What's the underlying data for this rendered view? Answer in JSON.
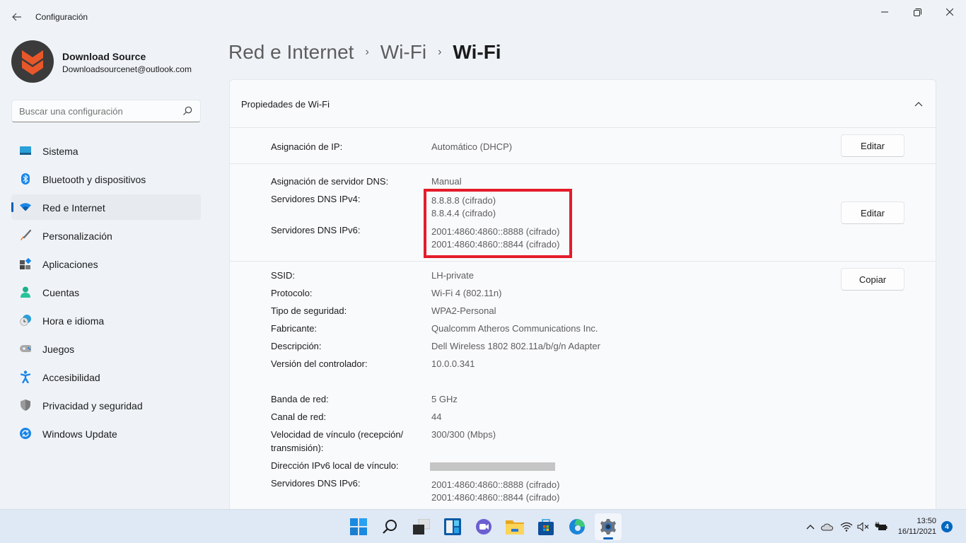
{
  "window": {
    "title": "Configuración",
    "back_icon": "arrow-left-icon",
    "controls": [
      "minimize-icon",
      "maximize-icon",
      "close-icon"
    ]
  },
  "profile": {
    "name": "Download Source",
    "email": "Downloadsourcenet@outlook.com",
    "avatar_icon": "download-source-logo-icon"
  },
  "search": {
    "placeholder": "Buscar una configuración",
    "value": "",
    "icon": "search-icon"
  },
  "sidebar": {
    "items": [
      {
        "label": "Sistema",
        "icon": "system-display-icon",
        "active": false
      },
      {
        "label": "Bluetooth y dispositivos",
        "icon": "bluetooth-icon",
        "active": false
      },
      {
        "label": "Red e Internet",
        "icon": "wifi-icon",
        "active": true
      },
      {
        "label": "Personalización",
        "icon": "paintbrush-icon",
        "active": false
      },
      {
        "label": "Aplicaciones",
        "icon": "apps-icon",
        "active": false
      },
      {
        "label": "Cuentas",
        "icon": "account-icon",
        "active": false
      },
      {
        "label": "Hora e idioma",
        "icon": "clock-globe-icon",
        "active": false
      },
      {
        "label": "Juegos",
        "icon": "gamepad-icon",
        "active": false
      },
      {
        "label": "Accesibilidad",
        "icon": "accessibility-icon",
        "active": false
      },
      {
        "label": "Privacidad y seguridad",
        "icon": "shield-icon",
        "active": false
      },
      {
        "label": "Windows Update",
        "icon": "windows-update-icon",
        "active": false
      }
    ]
  },
  "breadcrumb": {
    "items": [
      "Red e Internet",
      "Wi-Fi",
      "Wi-Fi"
    ],
    "separator": "›"
  },
  "card": {
    "title": "Propiedades de Wi-Fi",
    "collapse_icon": "chevron-up-icon",
    "ip_section": {
      "label": "Asignación de IP:",
      "value": "Automático (DHCP)",
      "button": "Editar"
    },
    "dns_section": {
      "assignment_label": "Asignación de servidor DNS:",
      "assignment_value": "Manual",
      "ipv4_label": "Servidores DNS IPv4:",
      "ipv4_values": [
        "8.8.8.8 (cifrado)",
        "8.8.4.4 (cifrado)"
      ],
      "ipv6_label": "Servidores DNS IPv6:",
      "ipv6_values": [
        "2001:4860:4860::8888 (cifrado)",
        "2001:4860:4860::8844 (cifrado)"
      ],
      "button": "Editar",
      "highlight_color": "#e41c2a"
    },
    "details_section": {
      "button": "Copiar",
      "rows": [
        {
          "label": "SSID:",
          "value": "LH-private"
        },
        {
          "label": "Protocolo:",
          "value": "Wi-Fi 4 (802.11n)"
        },
        {
          "label": "Tipo de seguridad:",
          "value": "WPA2-Personal"
        },
        {
          "label": "Fabricante:",
          "value": "Qualcomm Atheros Communications Inc."
        },
        {
          "label": "Descripción:",
          "value": "Dell Wireless 1802 802.11a/b/g/n Adapter"
        },
        {
          "label": "Versión del controlador:",
          "value": "10.0.0.341"
        },
        {
          "label": "Banda de red:",
          "value": "5 GHz"
        },
        {
          "label": "Canal de red:",
          "value": "44"
        },
        {
          "label": "Velocidad de vínculo (recepción/",
          "label2": "transmisión):",
          "value": "300/300 (Mbps)"
        },
        {
          "label": "Dirección IPv6 local de vínculo:",
          "value": "[redacted]"
        },
        {
          "label": "Servidores DNS IPv6:",
          "value": "2001:4860:4860::8888 (cifrado)",
          "value2": "2001:4860:4860::8844 (cifrado)"
        }
      ]
    }
  },
  "taskbar": {
    "apps": [
      "windows-start-icon",
      "search-icon",
      "task-view-icon",
      "widgets-icon",
      "teams-chat-icon",
      "file-explorer-icon",
      "microsoft-store-icon",
      "edge-icon",
      "settings-icon"
    ],
    "active_app": "settings-icon",
    "tray": [
      "chevron-up-icon",
      "onedrive-cloud-icon",
      "wifi-icon",
      "volume-muted-icon",
      "battery-charging-icon"
    ],
    "time": "13:50",
    "date": "16/11/2021",
    "notification_count": "4"
  },
  "colors": {
    "accent": "#005fb8",
    "background": "#eff3f8",
    "card": "#f9fafc",
    "highlight": "#e41c2a"
  }
}
